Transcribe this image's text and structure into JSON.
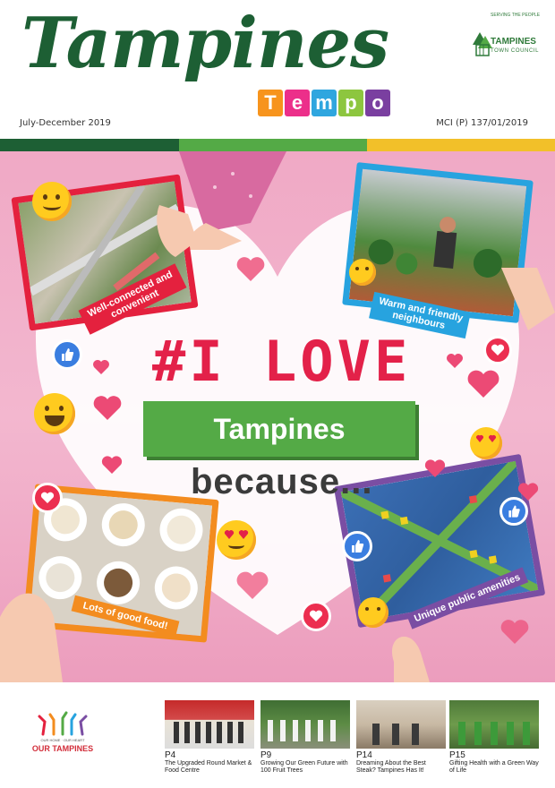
{
  "header": {
    "title": "Tampines",
    "tempo_letters": [
      "T",
      "e",
      "m",
      "p",
      "o"
    ],
    "tempo_colors": [
      "#f7941d",
      "#ec2f8a",
      "#2fa6df",
      "#8dc63f",
      "#7a3fa0"
    ],
    "issue": "July-December 2019",
    "mci": "MCI (P) 137/01/2019",
    "council_name": "TAMPINES",
    "council_sub": "TOWN COUNCIL",
    "council_motto": "SERVING THE PEOPLE"
  },
  "stripe_colors": [
    "#1d5f34",
    "#54aa46",
    "#f2c029"
  ],
  "cover": {
    "headline": "#I LOVE",
    "town": "Tampines",
    "because": "because...",
    "captions": {
      "transport": "Well-connected and convenient",
      "people": "Warm and friendly neighbours",
      "food": "Lots of good food!",
      "amenities": "Unique public amenities"
    }
  },
  "footer": {
    "logo_text_small": "OUR HOME · OUR HEART",
    "logo_text": "OUR TAMPINES",
    "articles": [
      {
        "page": "P4",
        "desc": "The Upgraded Round Market & Food Centre"
      },
      {
        "page": "P9",
        "desc": "Growing Our Green Future with 100 Fruit Trees"
      },
      {
        "page": "P14",
        "desc": "Dreaming About the Best Steak? Tampines Has It!"
      },
      {
        "page": "P15",
        "desc": "Gifting Health with a Green Way of Life"
      }
    ]
  }
}
